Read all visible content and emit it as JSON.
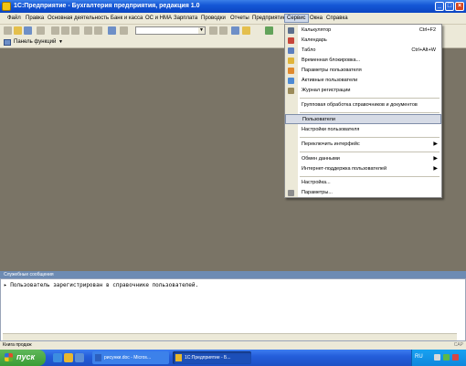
{
  "window": {
    "title": "1С:Предприятие - Бухгалтерия предприятия, редакция 1.0"
  },
  "menubar": {
    "items": [
      {
        "label": "Файл"
      },
      {
        "label": "Правка"
      },
      {
        "label": "Основная деятельность"
      },
      {
        "label": "Банк и касса"
      },
      {
        "label": "ОС и НМА"
      },
      {
        "label": "Зарплата"
      },
      {
        "label": "Проводки"
      },
      {
        "label": "Отчеты"
      },
      {
        "label": "Предприятие"
      },
      {
        "label": "Сервис"
      },
      {
        "label": "Окна"
      },
      {
        "label": "Справка"
      }
    ]
  },
  "panel_bar": {
    "label": "Панель функций"
  },
  "service_menu": {
    "items": [
      {
        "label": "Калькулятор",
        "shortcut": "Ctrl+F2",
        "icon": "calculator-icon"
      },
      {
        "label": "Календарь",
        "shortcut": "",
        "icon": "calendar-icon"
      },
      {
        "label": "Табло",
        "shortcut": "Ctrl+Alt+W",
        "icon": "board-icon"
      },
      {
        "label": "Временная блокировка...",
        "shortcut": "",
        "icon": "lock-icon"
      },
      {
        "label": "Параметры пользователя",
        "shortcut": "",
        "icon": "user-params-icon"
      },
      {
        "label": "Активные пользователи",
        "shortcut": "",
        "icon": "active-users-icon"
      },
      {
        "label": "Журнал регистрации",
        "shortcut": "",
        "icon": "log-icon"
      },
      {
        "label": "Групповая обработка справочников и документов",
        "shortcut": ""
      },
      {
        "label": "Пользователи",
        "shortcut": ""
      },
      {
        "label": "Настройки пользователя",
        "shortcut": ""
      },
      {
        "label": "Переключить интерфейс",
        "submenu": "▶"
      },
      {
        "label": "Обмен данными",
        "submenu": "▶"
      },
      {
        "label": "Интернет-поддержка пользователей",
        "submenu": "▶"
      },
      {
        "label": "Настройка...",
        "shortcut": ""
      },
      {
        "label": "Параметры...",
        "shortcut": "",
        "icon": "wrench-icon"
      }
    ]
  },
  "messages": {
    "header": "Служебные сообщения",
    "line": "Пользователь зарегистрирован в справочнике пользователей."
  },
  "statusbar": {
    "left": "Книга продаж",
    "right": "CAP"
  },
  "taskbar": {
    "start_label": "пуск",
    "tasks": [
      {
        "label": "рисунки.doc - Micros..."
      },
      {
        "label": "1С:Предприятие - Б..."
      }
    ],
    "tray_lang": "RU"
  },
  "colors": {
    "workspace": "#7a7466",
    "titlebar": "#1457d6",
    "menu_highlight": "#d6dbe6"
  }
}
